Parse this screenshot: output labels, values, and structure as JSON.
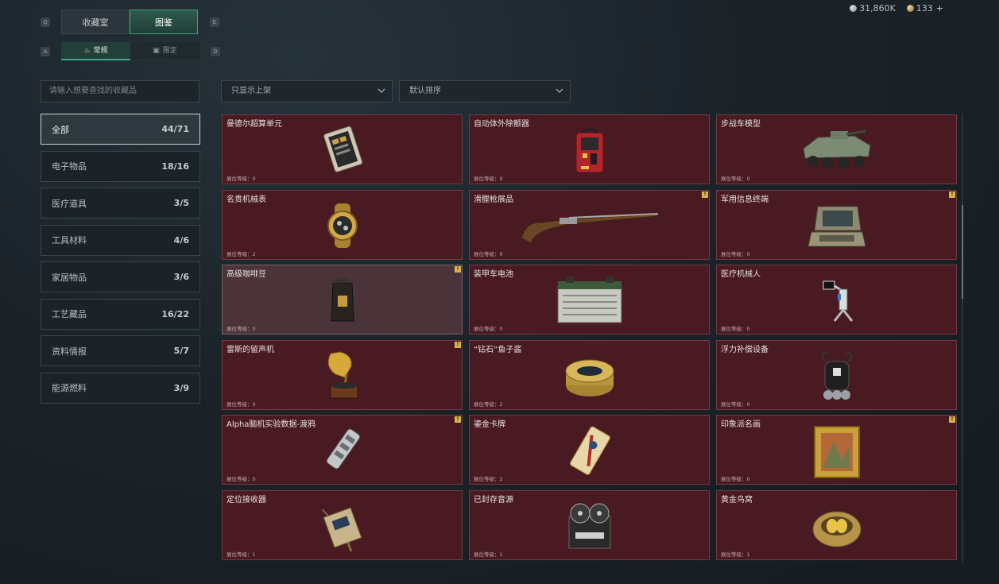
{
  "header": {
    "tabs": [
      {
        "label": "收藏室",
        "active": false
      },
      {
        "label": "图鉴",
        "active": true
      }
    ],
    "key_hints": {
      "left": "Q",
      "right": "E",
      "sub_left": "A",
      "sub_right": "D"
    },
    "sub_tabs": [
      {
        "label": "常规",
        "icon": "flame-icon",
        "active": true
      },
      {
        "label": "限定",
        "icon": "badge-icon",
        "active": false
      }
    ],
    "currency": {
      "silver": "31,860K",
      "gold": "133",
      "plus": "+"
    }
  },
  "filters": {
    "search_placeholder": "请输入想要查找的收藏品",
    "shelf_filter": "只显示上架",
    "sort": "默认排序"
  },
  "categories": [
    {
      "label": "全部",
      "count": "44/71",
      "active": true
    },
    {
      "label": "电子物品",
      "count": "18/16",
      "active": false
    },
    {
      "label": "医疗道具",
      "count": "3/5",
      "active": false
    },
    {
      "label": "工具材料",
      "count": "4/6",
      "active": false
    },
    {
      "label": "家居物品",
      "count": "3/6",
      "active": false
    },
    {
      "label": "工艺藏品",
      "count": "16/22",
      "active": false
    },
    {
      "label": "资料情报",
      "count": "5/7",
      "active": false
    },
    {
      "label": "能源燃料",
      "count": "3/9",
      "active": false
    }
  ],
  "items": [
    {
      "name": "曼德尔超算单元",
      "level": "展位等级：0",
      "icon": "supercomputer-icon",
      "badge": false
    },
    {
      "name": "自动体外除颤器",
      "level": "展位等级：0",
      "icon": "defibrillator-icon",
      "badge": false
    },
    {
      "name": "步战车模型",
      "level": "展位等级：0",
      "icon": "ifv-model-icon",
      "badge": false
    },
    {
      "name": "名贵机械表",
      "level": "展位等级：2",
      "icon": "watch-icon",
      "badge": false
    },
    {
      "name": "滑膛枪展品",
      "level": "展位等级：0",
      "icon": "musket-icon",
      "badge": true
    },
    {
      "name": "军用信息终端",
      "level": "展位等级：0",
      "icon": "terminal-icon",
      "badge": true
    },
    {
      "name": "高级咖啡豆",
      "level": "展位等级：0",
      "icon": "coffee-bag-icon",
      "badge": true
    },
    {
      "name": "装甲车电池",
      "level": "展位等级：0",
      "icon": "battery-icon",
      "badge": false
    },
    {
      "name": "医疗机械人",
      "level": "展位等级：0",
      "icon": "medical-robot-icon",
      "badge": false
    },
    {
      "name": "雷斯的留声机",
      "level": "展位等级：0",
      "icon": "gramophone-icon",
      "badge": true
    },
    {
      "name": "“钻石”鱼子酱",
      "level": "展位等级：2",
      "icon": "caviar-icon",
      "badge": false
    },
    {
      "name": "浮力补偿设备",
      "level": "展位等级：0",
      "icon": "bcd-icon",
      "badge": false
    },
    {
      "name": "Alpha脑机实验数据-渡鸦",
      "level": "展位等级：0",
      "icon": "data-drive-icon",
      "badge": true
    },
    {
      "name": "鎏金卡牌",
      "level": "展位等级：2",
      "icon": "card-icon",
      "badge": false
    },
    {
      "name": "印象派名画",
      "level": "展位等级：0",
      "icon": "painting-icon",
      "badge": true
    },
    {
      "name": "定位接收器",
      "level": "展位等级：1",
      "icon": "receiver-icon",
      "badge": false
    },
    {
      "name": "已封存音源",
      "level": "展位等级：1",
      "icon": "reel-recorder-icon",
      "badge": false
    },
    {
      "name": "黄金鸟窝",
      "level": "展位等级：1",
      "icon": "golden-nest-icon",
      "badge": false
    }
  ],
  "colors": {
    "accent": "#39b08b",
    "card_bg": "#4a1a22",
    "badge": "#d9b44a"
  }
}
